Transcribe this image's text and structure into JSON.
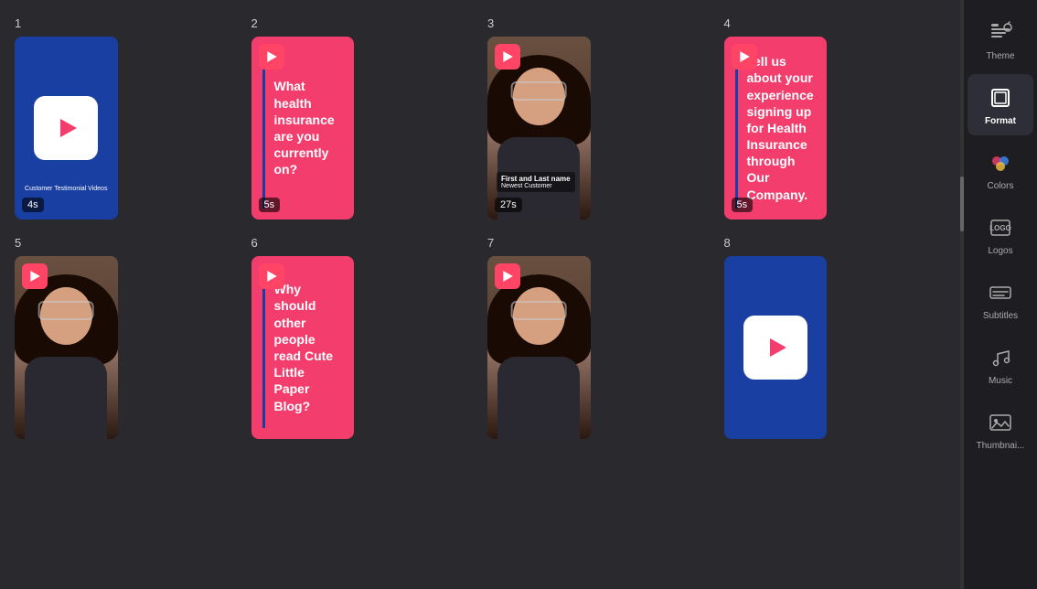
{
  "grid": {
    "items": [
      {
        "number": "1",
        "type": "logo-blue",
        "duration": "4s",
        "bg": "blue",
        "logo_text": "Customer Testimonial Videos"
      },
      {
        "number": "2",
        "type": "text-pink",
        "duration": "5s",
        "bg": "pink",
        "text": "What health insurance are you currently on?"
      },
      {
        "number": "3",
        "type": "video",
        "duration": "27s",
        "name": "First and Last name",
        "role": "Newest Customer"
      },
      {
        "number": "4",
        "type": "text-pink",
        "duration": "5s",
        "bg": "pink",
        "text": "Tell us about your experience signing up for Health Insurance through Our Company."
      },
      {
        "number": "5",
        "type": "video",
        "duration": null
      },
      {
        "number": "6",
        "type": "text-pink",
        "duration": null,
        "bg": "pink",
        "text": "Why should other people read Cute Little Paper Blog?"
      },
      {
        "number": "7",
        "type": "video",
        "duration": null
      },
      {
        "number": "8",
        "type": "logo-blue",
        "duration": null,
        "bg": "blue"
      }
    ]
  },
  "sidebar": {
    "items": [
      {
        "id": "theme",
        "label": "Theme",
        "active": false
      },
      {
        "id": "format",
        "label": "Format",
        "active": true
      },
      {
        "id": "colors",
        "label": "Colors",
        "active": false
      },
      {
        "id": "logos",
        "label": "Logos",
        "active": false
      },
      {
        "id": "subtitles",
        "label": "Subtitles",
        "active": false
      },
      {
        "id": "music",
        "label": "Music",
        "active": false
      },
      {
        "id": "thumbnail",
        "label": "Thumbnai...",
        "active": false
      }
    ]
  }
}
